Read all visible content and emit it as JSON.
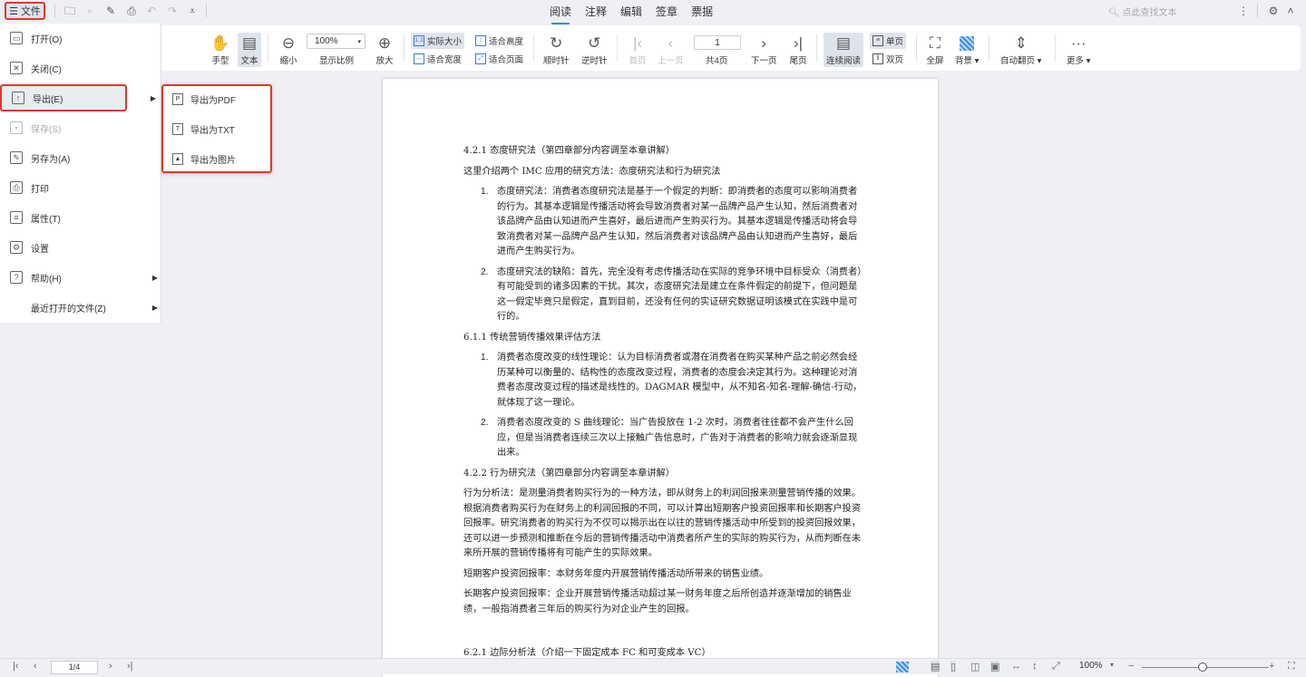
{
  "topbar": {
    "file_label": "文件",
    "tabs": [
      "阅读",
      "注释",
      "编辑",
      "签章",
      "票据"
    ],
    "active_tab": "阅读",
    "search_placeholder": "点此查找文本"
  },
  "toolbar": {
    "hand": "手型",
    "text": "文本",
    "zoom_out": "缩小",
    "zoom_value": "100%",
    "zoom_label": "显示比例",
    "zoom_in": "放大",
    "actual_size": "实际大小",
    "fit_height": "适合高度",
    "fit_width": "适合宽度",
    "fit_page": "适合页面",
    "rotate_cw": "顺时针",
    "rotate_ccw": "逆时针",
    "first": "首页",
    "prev": "上一页",
    "page_value": "1",
    "page_total": "共4页",
    "next": "下一页",
    "last": "尾页",
    "continuous": "连续阅读",
    "single": "单页",
    "double": "双页",
    "fullscreen": "全屏",
    "background": "背景",
    "auto_flip": "自动翻页",
    "more": "更多"
  },
  "menu": {
    "items": [
      {
        "label": "打开(O)",
        "icon": "folder-icon",
        "glyph": "▭"
      },
      {
        "label": "关闭(C)",
        "icon": "close-icon",
        "glyph": "✕"
      },
      {
        "label": "导出(E)",
        "icon": "export-icon",
        "glyph": "↑",
        "submenu": true
      },
      {
        "label": "保存(S)",
        "icon": "save-icon",
        "glyph": "▪",
        "disabled": true
      },
      {
        "label": "另存为(A)",
        "icon": "save-as-icon",
        "glyph": "✎"
      },
      {
        "label": "打印",
        "icon": "print-icon",
        "glyph": "⎙"
      },
      {
        "label": "属性(T)",
        "icon": "properties-icon",
        "glyph": "≡"
      },
      {
        "label": "设置",
        "icon": "settings-icon",
        "glyph": "⚙"
      },
      {
        "label": "帮助(H)",
        "icon": "help-icon",
        "glyph": "?",
        "submenu": true
      },
      {
        "label": "最近打开的文件(Z)",
        "icon": "",
        "glyph": "",
        "submenu": true
      }
    ]
  },
  "submenu": {
    "items": [
      {
        "label": "导出为PDF",
        "glyph": "P"
      },
      {
        "label": "导出为TXT",
        "glyph": "T"
      },
      {
        "label": "导出为图片",
        "glyph": "▲"
      }
    ]
  },
  "doc": {
    "blocks": [
      {
        "t": "p",
        "text": "4.2.1 态度研究法（第四章部分内容调至本章讲解）"
      },
      {
        "t": "p",
        "text": "这里介绍两个 IMC 应用的研究方法：态度研究法和行为研究法"
      },
      {
        "t": "li",
        "n": "1.",
        "text": "态度研究法：消费者态度研究法是基于一个假定的判断：即消费者的态度可以影响消费者的行为。其基本逻辑是传播活动将会导致消费者对某一品牌产品产生认知，然后消费者对该品牌产品由认知进而产生喜好，最后进而产生购买行为。其基本逻辑是传播活动将会导致消费者对某一品牌产品产生认知，然后消费者对该品牌产品由认知进而产生喜好，最后进而产生购买行为。"
      },
      {
        "t": "li",
        "n": "2.",
        "text": "态度研究法的缺陷：首先，完全没有考虑传播活动在实际的竞争环境中目标受众（消费者）有可能受到的诸多因素的干扰。其次，态度研究法是建立在条件假定的前提下，但问题是这一假定毕竟只是假定，直到目前，还没有任何的实证研究数据证明该模式在实践中是可行的。"
      },
      {
        "t": "p",
        "text": "6.1.1 传统营销传播效果评估方法"
      },
      {
        "t": "li",
        "n": "1.",
        "text": "消费者态度改变的线性理论：认为目标消费者或潜在消费者在购买某种产品之前必然会经历某种可以衡量的、结构性的态度改变过程，消费者的态度会决定其行为。这种理论对消费者态度改变过程的描述是线性的。DAGMAR 模型中，从不知名-知名-理解-确信-行动，就体现了这一理论。"
      },
      {
        "t": "li",
        "n": "2.",
        "text": "消费者态度改变的 S 曲线理论：当广告投放在 1-2 次时，消费者往往都不会产生什么回应，但是当消费者连续三次以上接触广告信息时，广告对于消费者的影响力就会逐渐显现出来。"
      },
      {
        "t": "p",
        "text": "4.2.2 行为研究法（第四章部分内容调至本章讲解）"
      },
      {
        "t": "p",
        "text": "行为分析法：是测量消费者购买行为的一种方法，即从财务上的利润回报来测量营销传播的效果。根据消费者购买行为在财务上的利润回报的不同，可以计算出短期客户投资回报率和长期客户投资回报率。研究消费者的购买行为不仅可以揭示出在以往的营销传播活动中所受到的投资回报效果，还可以进一步预测和推断在今后的营销传播活动中消费者所产生的实际的购买行为，从而判断在未来所开展的营销传播将有可能产生的实际效果。"
      },
      {
        "t": "p",
        "text": "短期客户投资回报率：本财务年度内开展营销传播活动所带来的销售业绩。"
      },
      {
        "t": "p",
        "text": "长期客户投资回报率：企业开展营销传播活动超过某一财务年度之后所创造并逐渐增加的销售业绩，一般指消费者三年后的购买行为对企业产生的回报。"
      },
      {
        "t": "gap",
        "text": ""
      },
      {
        "t": "p",
        "text": "6.2.1 边际分析法（介绍一下固定成本 FC 和可变成本 VC）"
      }
    ]
  },
  "bottom": {
    "page_value": "1/4",
    "zoom_value": "100%",
    "zoom_fraction": 0.5
  }
}
